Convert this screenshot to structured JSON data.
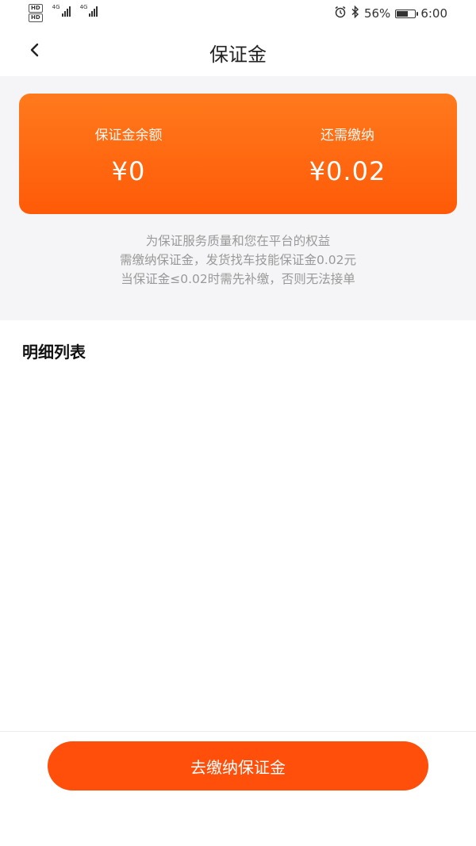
{
  "status_bar": {
    "hd1": "HD",
    "hd2": "HD",
    "net1": "4G",
    "net2": "4G",
    "battery_percent": "56%",
    "time": "6:00",
    "icons": [
      "alarm-icon",
      "bluetooth-icon",
      "battery-icon"
    ]
  },
  "nav": {
    "title": "保证金",
    "back_icon": "chevron-left-icon"
  },
  "card": {
    "balance_label": "保证金余额",
    "balance_amount": "¥0",
    "due_label": "还需缴纳",
    "due_amount": "¥0.02",
    "gradient_colors": [
      "#ff7a1c",
      "#ff5a07"
    ]
  },
  "notice": {
    "line1": "为保证服务质量和您在平台的权益",
    "line2": "需缴纳保证金，发货找车技能保证金0.02元",
    "line3": "当保证金≤0.02时需先补缴，否则无法接单"
  },
  "details": {
    "title": "明细列表"
  },
  "footer": {
    "pay_button_label": "去缴纳保证金",
    "button_color": "#ff4f0a"
  }
}
